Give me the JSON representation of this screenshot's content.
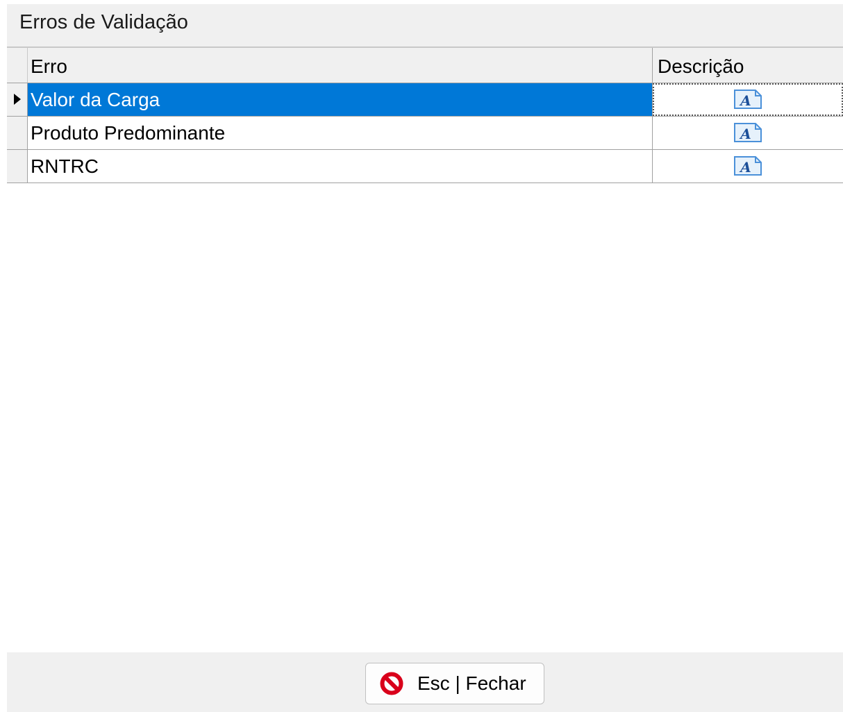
{
  "window": {
    "title": "Erros de Validação"
  },
  "grid": {
    "columns": {
      "erro": "Erro",
      "descricao": "Descrição"
    },
    "rows": [
      {
        "erro": "Valor da Carga",
        "descricao_icon": "text-document-icon",
        "selected": true
      },
      {
        "erro": "Produto Predominante",
        "descricao_icon": "text-document-icon",
        "selected": false
      },
      {
        "erro": "RNTRC",
        "descricao_icon": "text-document-icon",
        "selected": false
      }
    ],
    "selection_color": "#0078d7"
  },
  "footer": {
    "close_button": {
      "label": "Esc | Fechar",
      "icon": "stop-icon",
      "icon_color": "#d9001b"
    }
  }
}
